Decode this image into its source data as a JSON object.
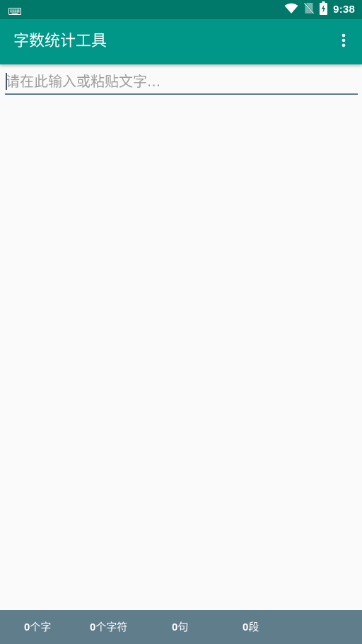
{
  "status_bar": {
    "time": "9:38",
    "icons": [
      "keyboard-icon",
      "wifi-icon",
      "no-sim-icon",
      "battery-charging-icon"
    ],
    "background": "#00796b"
  },
  "app_bar": {
    "title": "字数统计工具",
    "menu_icon": "more-vertical-icon",
    "background": "#009688"
  },
  "editor": {
    "placeholder": "请在此输入或粘贴文字...",
    "value": "",
    "underline_color": "#607d8b"
  },
  "stats": {
    "background": "#607d8b",
    "chars": {
      "count": "0",
      "unit": "个字"
    },
    "characters": {
      "count": "0",
      "unit": "个字符"
    },
    "sentences": {
      "count": "0",
      "unit": "句"
    },
    "paragraphs": {
      "count": "0",
      "unit": "段"
    }
  }
}
